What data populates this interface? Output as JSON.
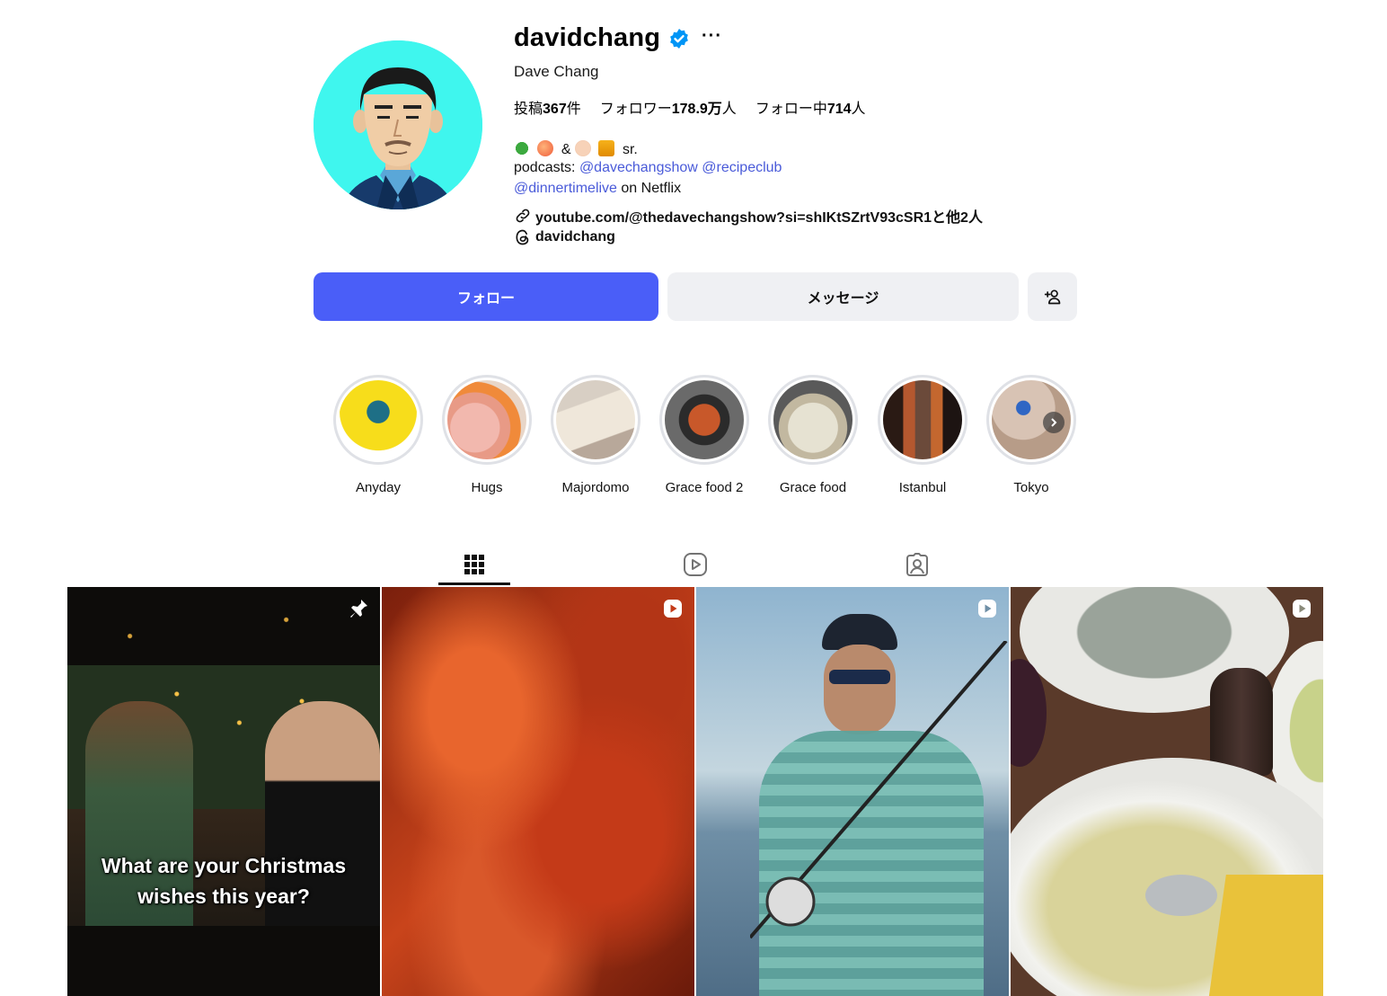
{
  "profile": {
    "username": "davidchang",
    "full_name": "Dave Chang",
    "more_label": "···",
    "stats": {
      "posts_label": "投稿",
      "posts_value": "367",
      "posts_suffix": "件",
      "followers_label": "フォロワー",
      "followers_value": "178.9万",
      "followers_suffix": "人",
      "following_label": "フォロー中",
      "following_value": "714",
      "following_suffix": "人"
    },
    "bio": {
      "line1_amp": "&",
      "line1_end": "sr.",
      "line2_prefix": "podcasts:",
      "mention_1": "@davechangshow",
      "mention_2": "@recipeclub",
      "mention_3": "@dinnertimelive",
      "line3_suffix": "on Netflix",
      "link_text": "youtube.com/@thedavechangshow?si=shIKtSZrtV93cSR1",
      "link_more": "と他2人",
      "threads_handle": "davidchang"
    }
  },
  "actions": {
    "follow_label": "フォロー",
    "message_label": "メッセージ"
  },
  "highlights": [
    {
      "label": "Anyday"
    },
    {
      "label": "Hugs"
    },
    {
      "label": "Majordomo"
    },
    {
      "label": "Grace food 2"
    },
    {
      "label": "Grace food"
    },
    {
      "label": "Istanbul"
    },
    {
      "label": "Tokyo"
    }
  ],
  "posts": [
    {
      "caption_line1": "What are your Christmas",
      "caption_line2": "wishes this year?"
    }
  ],
  "colors": {
    "accent": "#4a5ef8",
    "verified": "#0095f6",
    "mention": "#4a5bd9",
    "button_secondary": "#eff0f3"
  }
}
